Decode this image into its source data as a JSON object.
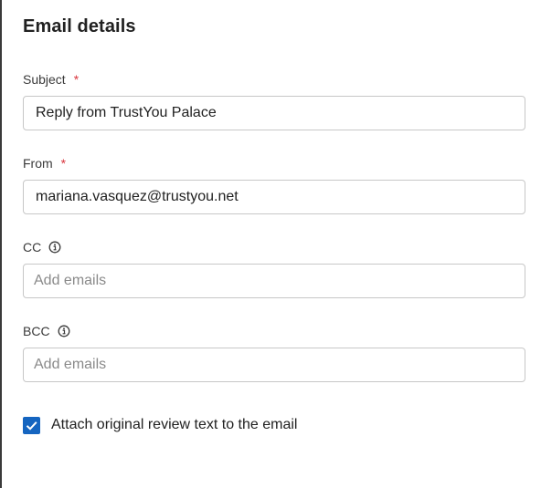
{
  "dialog": {
    "title": "Email details"
  },
  "fields": {
    "subject": {
      "label": "Subject",
      "required_mark": "*",
      "value": "Reply from TrustYou Palace"
    },
    "from": {
      "label": "From",
      "required_mark": "*",
      "value": "mariana.vasquez@trustyou.net"
    },
    "cc": {
      "label": "CC",
      "info_icon": "info-icon",
      "placeholder": "Add emails"
    },
    "bcc": {
      "label": "BCC",
      "info_icon": "info-icon",
      "placeholder": "Add emails"
    }
  },
  "attach_review": {
    "label": "Attach original review text to the email",
    "checked": true
  },
  "colors": {
    "accent": "#1565c0",
    "required": "#d9363e",
    "border": "#c7c7c7"
  }
}
